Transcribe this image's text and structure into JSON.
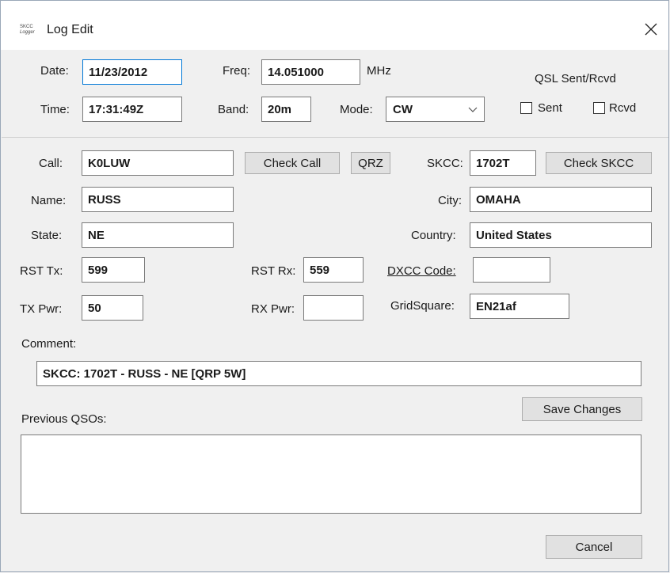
{
  "window": {
    "title": "Log Edit",
    "app_icon_line1": "SKCC",
    "app_icon_line2": "Logger"
  },
  "qso": {
    "date_label": "Date:",
    "date": "11/23/2012",
    "time_label": "Time:",
    "time": "17:31:49Z",
    "freq_label": "Freq:",
    "freq": "14.051000",
    "freq_unit": "MHz",
    "band_label": "Band:",
    "band": "20m",
    "mode_label": "Mode:",
    "mode": "CW"
  },
  "qsl": {
    "heading": "QSL Sent/Rcvd",
    "sent_label": "Sent",
    "sent_checked": false,
    "rcvd_label": "Rcvd",
    "rcvd_checked": false
  },
  "station": {
    "call_label": "Call:",
    "call": "K0LUW",
    "check_call_label": "Check Call",
    "qrz_label": "QRZ",
    "skcc_label": "SKCC:",
    "skcc": "1702T",
    "check_skcc_label": "Check SKCC",
    "name_label": "Name:",
    "name": "RUSS",
    "city_label": "City:",
    "city": "OMAHA",
    "state_label": "State:",
    "state": "NE",
    "country_label": "Country:",
    "country": "United States",
    "rst_tx_label": "RST Tx:",
    "rst_tx": "599",
    "rst_rx_label": "RST Rx:",
    "rst_rx": "559",
    "dxcc_label": "DXCC Code:",
    "dxcc": "",
    "tx_pwr_label": "TX Pwr:",
    "tx_pwr": "50",
    "rx_pwr_label": "RX Pwr:",
    "rx_pwr": "",
    "grid_label": "GridSquare:",
    "grid": "EN21af"
  },
  "comment": {
    "label": "Comment:",
    "value": "SKCC: 1702T - RUSS - NE   [QRP 5W]"
  },
  "previous": {
    "label": "Previous QSOs:"
  },
  "actions": {
    "save_label": "Save Changes",
    "cancel_label": "Cancel"
  }
}
